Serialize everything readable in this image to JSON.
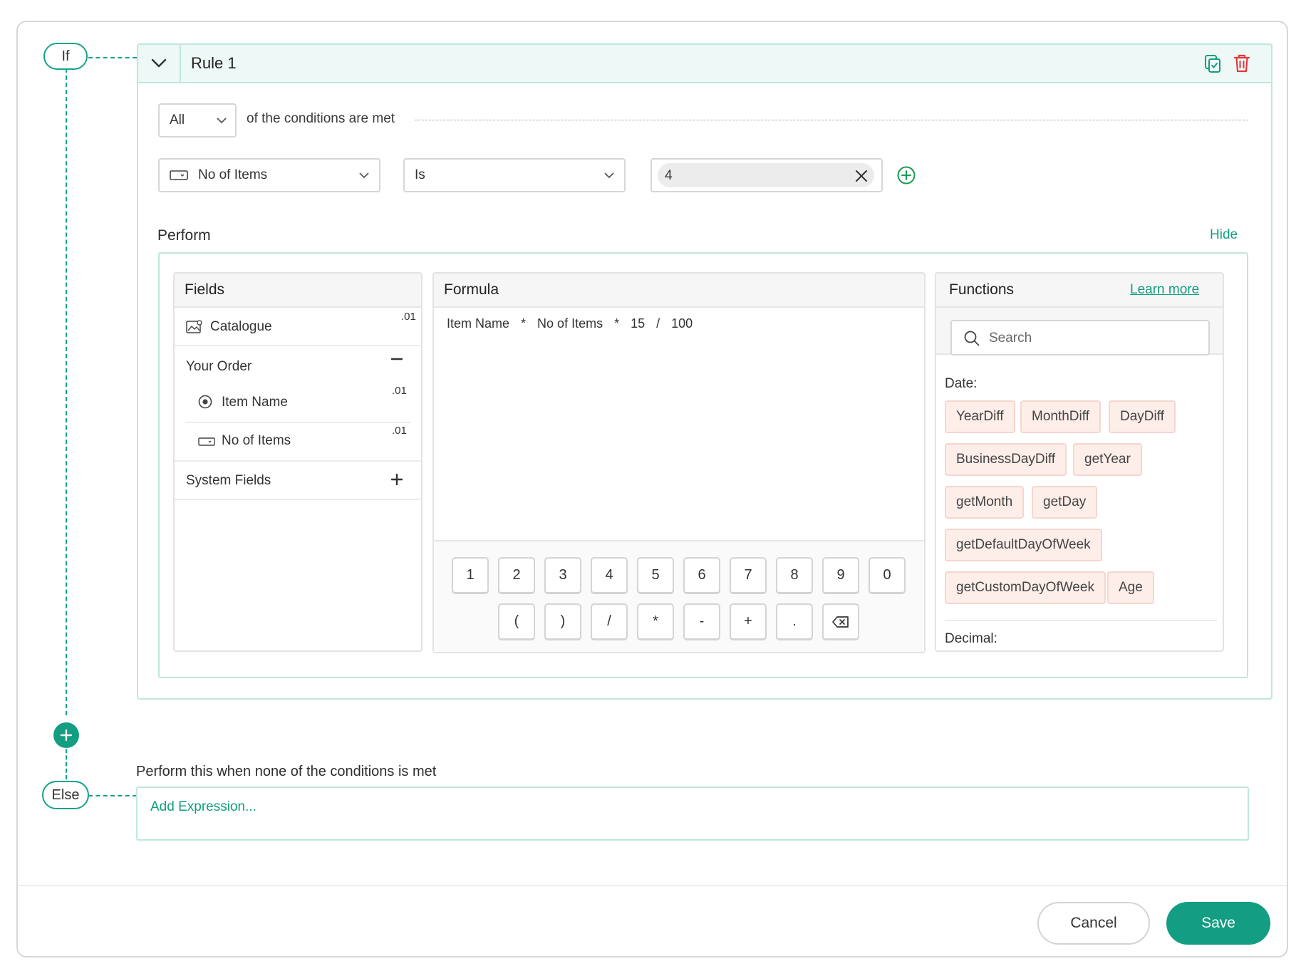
{
  "flow": {
    "if_label": "If",
    "else_label": "Else"
  },
  "rule": {
    "title": "Rule 1",
    "match_select": "All",
    "match_suffix": "of the conditions are met",
    "condition": {
      "field": "No of Items",
      "operator": "Is",
      "value": "4"
    }
  },
  "perform": {
    "label": "Perform",
    "hide_link": "Hide",
    "fields_panel": {
      "title": "Fields",
      "items": [
        {
          "label": "Catalogue",
          "tag": ".01"
        },
        {
          "label": "Your Order"
        },
        {
          "label": "Item Name",
          "tag": ".01"
        },
        {
          "label": "No of Items",
          "tag": ".01"
        },
        {
          "label": "System Fields"
        }
      ]
    },
    "formula_panel": {
      "title": "Formula",
      "tokens": [
        "Item Name",
        "*",
        "No of Items",
        "*",
        "15",
        "/",
        "100"
      ],
      "keypad_row1": [
        "1",
        "2",
        "3",
        "4",
        "5",
        "6",
        "7",
        "8",
        "9",
        "0"
      ],
      "keypad_row2": [
        "(",
        ")",
        "/",
        "*",
        "-",
        "+",
        "."
      ]
    },
    "functions_panel": {
      "title": "Functions",
      "learn_more": "Learn more",
      "search_placeholder": "Search",
      "date_label": "Date:",
      "date_functions": [
        "YearDiff",
        "MonthDiff",
        "DayDiff",
        "BusinessDayDiff",
        "getYear",
        "getMonth",
        "getDay",
        "getDefaultDayOfWeek",
        "getCustomDayOfWeek",
        "Age"
      ],
      "decimal_label": "Decimal:"
    }
  },
  "else_section": {
    "label": "Perform this when none of the conditions is met",
    "add_expression": "Add Expression..."
  },
  "footer": {
    "cancel": "Cancel",
    "save": "Save"
  },
  "colors": {
    "accent": "#139d82",
    "danger": "#e0393e",
    "chip_bg": "#fdeee9",
    "chip_border": "#f5d6cf"
  }
}
